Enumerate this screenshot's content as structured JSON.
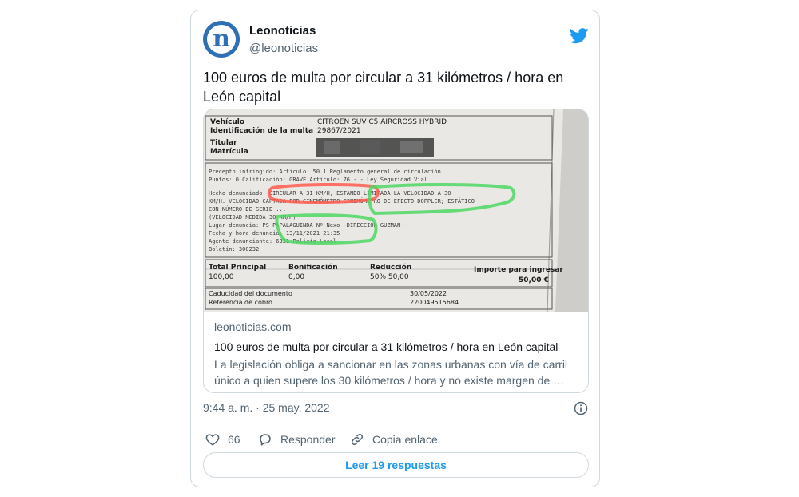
{
  "tweet": {
    "account_name": "Leonoticias",
    "handle": "@leonoticias_",
    "avatar_letter": "n",
    "text": "100 euros de multa por circular a 31 kilómetros / hora en León capital",
    "timestamp": "9:44 a. m. · 25 may. 2022"
  },
  "link_card": {
    "domain": "leonoticias.com",
    "title": "100 euros de multa por circular a 31 kilómetros / hora en León capital",
    "description": "La legislación obliga a sancionar en las zonas urbanas con vía de carril único a quien supere los 30 kilómetros / hora y no existe margen de …"
  },
  "photo_document": {
    "labels": {
      "vehiculo": "Vehículo",
      "identificacion": "Identificación de la multa",
      "titular": "Titular",
      "matricula": "Matrícula"
    },
    "vehicle": "CITROEN SUV C5 AIRCROSS HYBRID",
    "fine_id": "29867/2021",
    "lines": [
      "Precepto infringido: Artículo: 50.1 Reglamento general de circulación",
      "Puntos: 0 Calificación: GRAVE Artículo: 76.-.- Ley Seguridad Vial",
      "Hecho denunciado: CIRCULAR A 31  KM/H, ESTANDO LIMITADA LA VELOCIDAD A 30",
      "KM/H. VELOCIDAD CAPTADA POR CINEMÓMETRO CINEMÓMETRO DE EFECTO DOPPLER; ESTÁTICO",
      "CON NÚMERO DE SERIE ...",
      "(VELOCIDAD MEDIDA 30 KM/H)",
      "Lugar denuncia: PS PAPALAGUINDA Nº  Nexo -DIRECCION GUZMAN-",
      "Fecha y hora denuncia: 13/11/2021 21:35",
      "Agente denunciante: 6331 Policía Local",
      "Boletín: 300232"
    ],
    "totals": {
      "total_label": "Total Principal",
      "total_value": "100,00",
      "bonus_label": "Bonificación",
      "bonus_value": "0,00",
      "reduction_label": "Reducción",
      "reduction_value": "50% 50,00",
      "amount_label": "Importe para ingresar",
      "amount_value": "50,00 €"
    },
    "caducidad_label": "Caducidad del documento",
    "caducidad_value": "30/05/2022",
    "referencia_label": "Referencia de cobro",
    "referencia_value": "220049515684"
  },
  "actions": {
    "likes": "66",
    "reply_label": "Responder",
    "copy_label": "Copia enlace"
  },
  "replies_button": "Leer 19 respuestas",
  "colors": {
    "accent": "#1d9bf0",
    "brand_avatar": "#2f6fb3",
    "secondary_text": "#536471",
    "border": "#cfd9de"
  },
  "icons": [
    "leonoticias-logo",
    "twitter-bird-icon",
    "info-icon",
    "heart-icon",
    "reply-icon",
    "link-icon"
  ]
}
